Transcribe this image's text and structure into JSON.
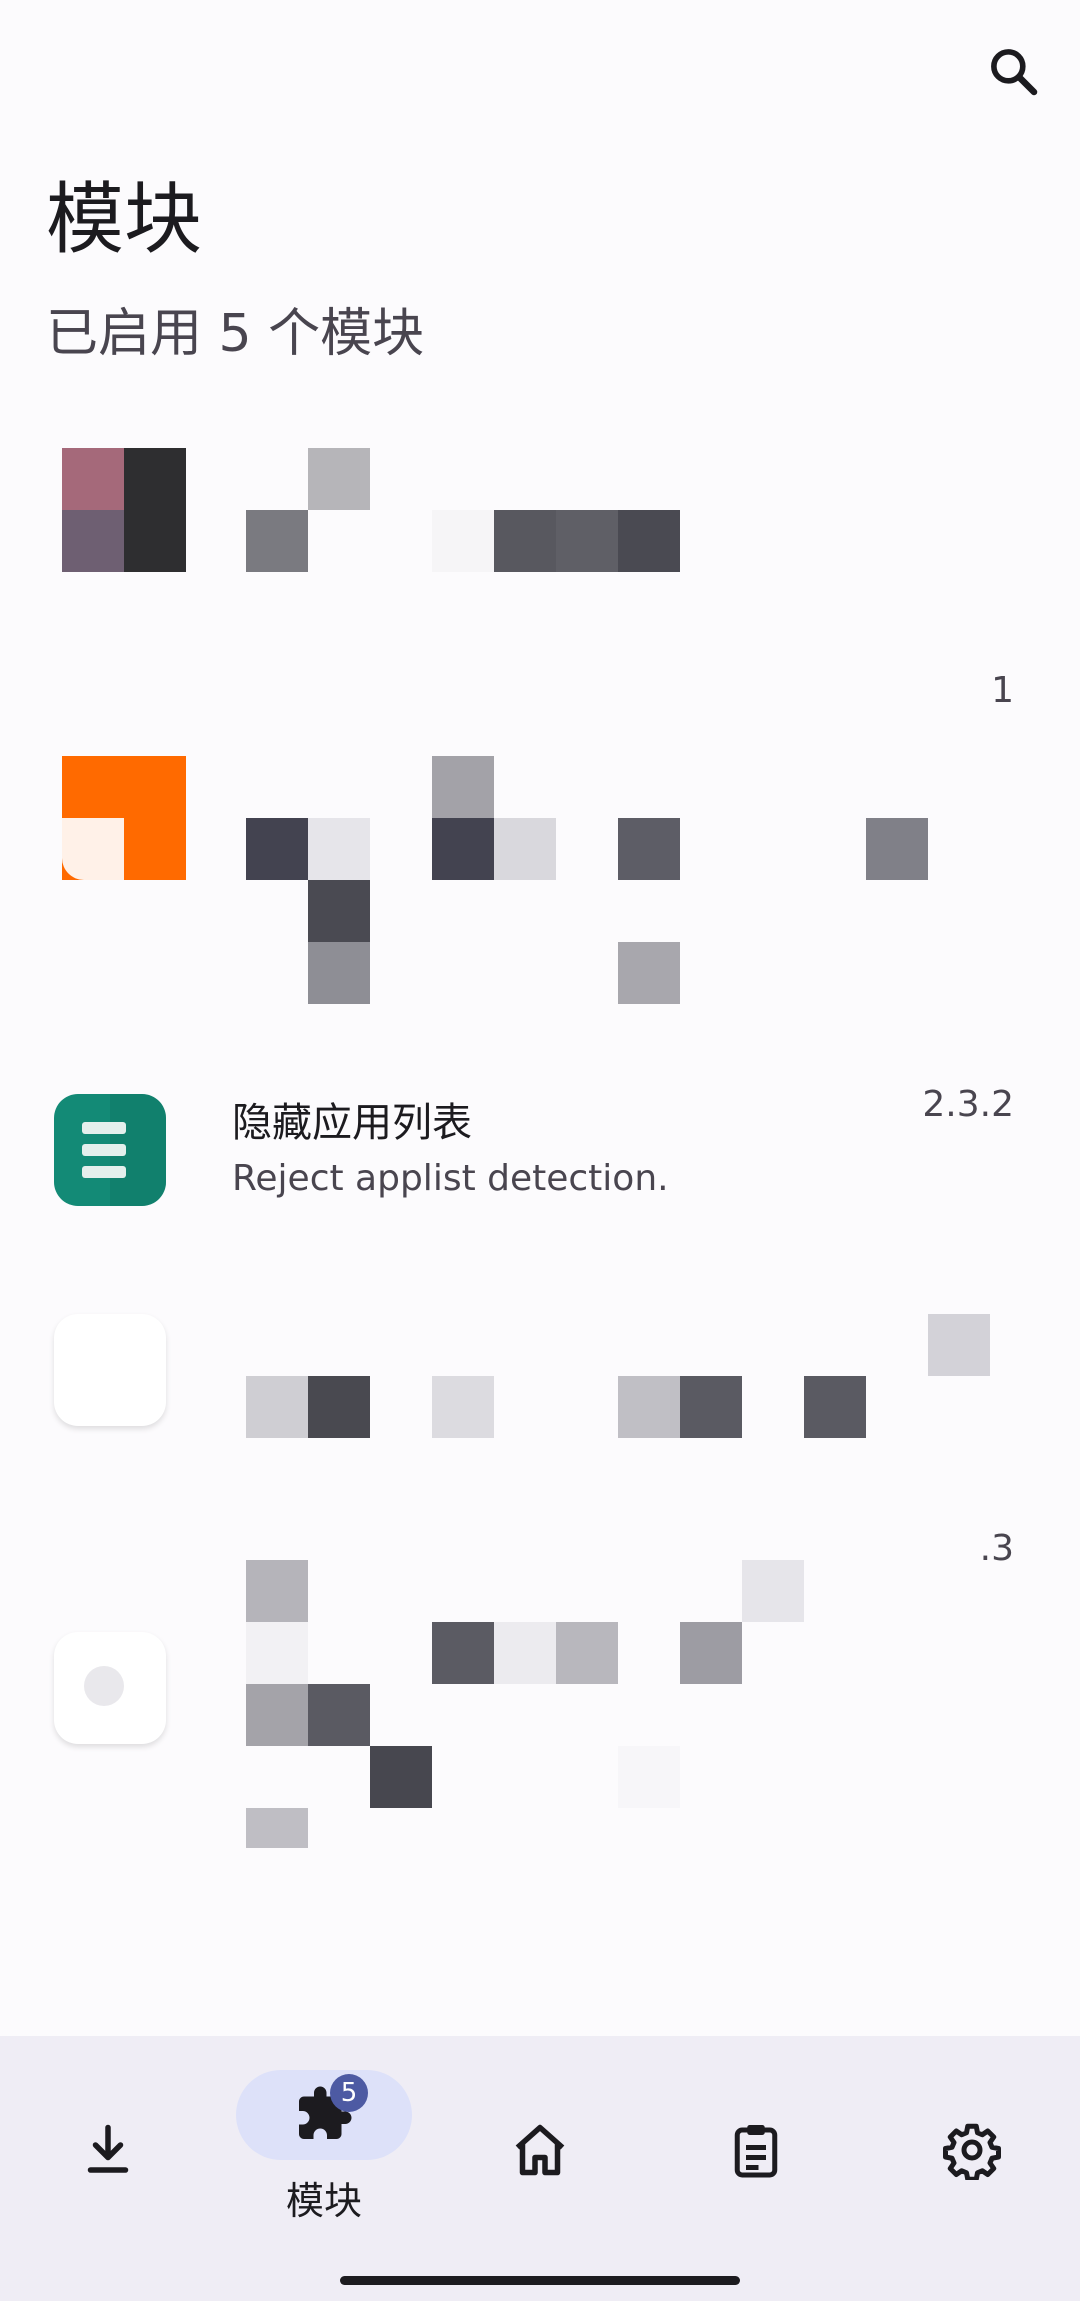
{
  "header": {
    "title": "模块",
    "subtitle": "已启用 5 个模块"
  },
  "modules": [
    {
      "version": ""
    },
    {
      "version": "1"
    },
    {
      "name": "隐藏应用列表",
      "description": "Reject applist detection.",
      "version": "2.3.2"
    },
    {
      "version": ""
    },
    {
      "version": ".3"
    }
  ],
  "nav": {
    "items": [
      {
        "id": "download",
        "label": ""
      },
      {
        "id": "modules",
        "label": "模块",
        "badge": "5"
      },
      {
        "id": "home",
        "label": ""
      },
      {
        "id": "logs",
        "label": ""
      },
      {
        "id": "settings",
        "label": ""
      }
    ]
  },
  "colors": {
    "accent": "#4d5aa3",
    "pill": "#dde1f9",
    "navbar": "#efedf5"
  }
}
